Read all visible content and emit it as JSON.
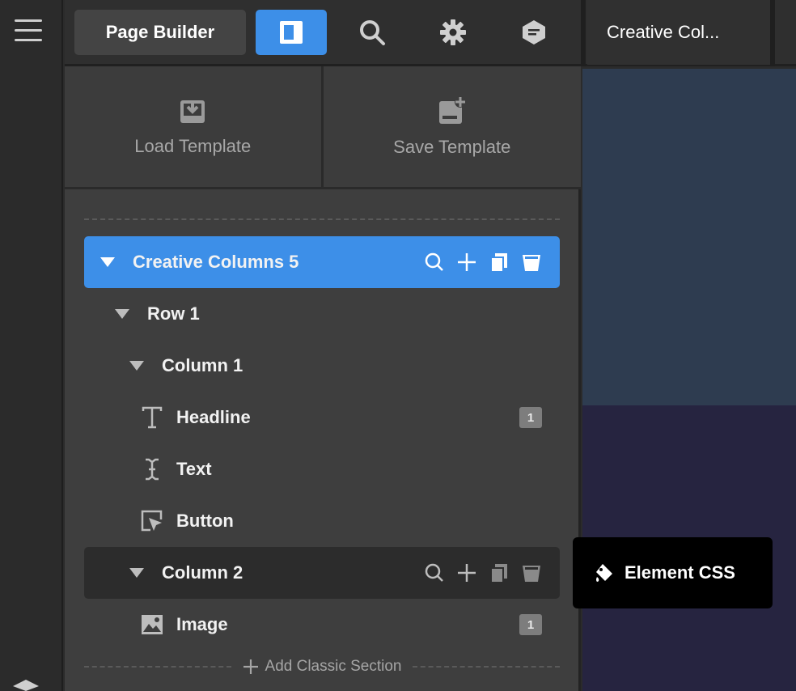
{
  "topbar": {
    "page_builder_label": "Page Builder",
    "page_tab_label": "Creative Col..."
  },
  "templates": {
    "load_label": "Load Template",
    "save_label": "Save Template"
  },
  "tree": {
    "section": {
      "label": "Creative Columns 5"
    },
    "row": {
      "label": "Row 1"
    },
    "column1": {
      "label": "Column 1"
    },
    "headline": {
      "label": "Headline",
      "badge": "1"
    },
    "text": {
      "label": "Text"
    },
    "button": {
      "label": "Button"
    },
    "column2": {
      "label": "Column 2"
    },
    "image": {
      "label": "Image",
      "badge": "1"
    }
  },
  "add_section_label": "Add Classic Section",
  "tooltip": {
    "label": "Element CSS"
  },
  "icons": {
    "menu": "hamburger-icon",
    "panel": "panel-toggle-icon",
    "search": "search-icon",
    "settings": "gear-icon",
    "notes": "note-icon",
    "load": "download-icon",
    "save": "save-template-icon",
    "headline": "headline-icon",
    "text": "text-cursor-icon",
    "button": "button-pointer-icon",
    "image": "image-icon",
    "css": "paint-bucket-icon"
  },
  "colors": {
    "accent": "#3d8fe8",
    "panel_bg": "#3e3e3e",
    "tooltip_bg": "#000000"
  }
}
